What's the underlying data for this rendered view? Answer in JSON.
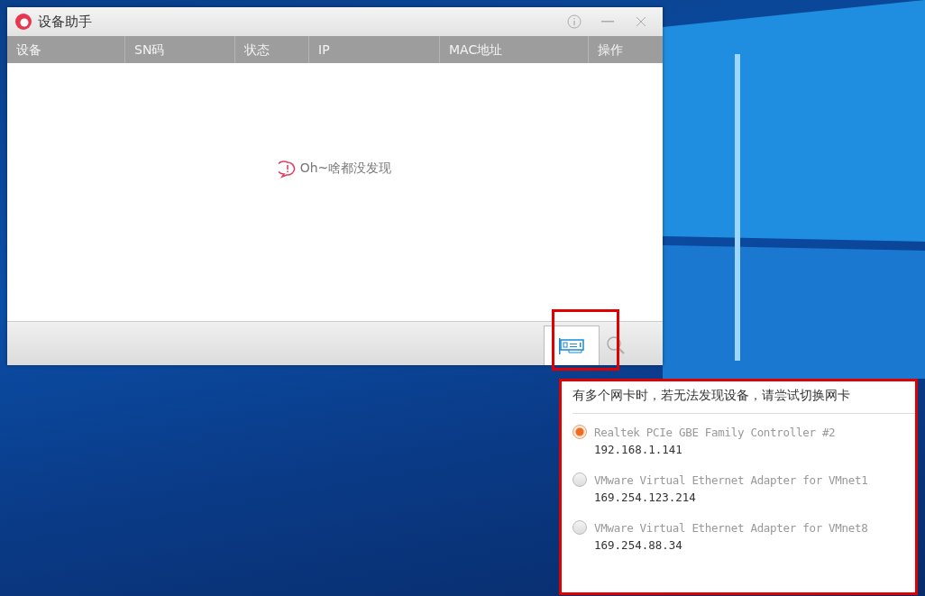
{
  "window": {
    "title": "设备助手"
  },
  "table": {
    "columns": [
      "设备",
      "SN码",
      "状态",
      "IP",
      "MAC地址",
      "操作"
    ],
    "empty_message": "Oh~啥都没发现"
  },
  "popup": {
    "hint": "有多个网卡时，若无法发现设备，请尝试切换网卡",
    "adapters": [
      {
        "name": "Realtek PCIe GBE Family Controller #2",
        "ip": "192.168.1.141",
        "selected": true
      },
      {
        "name": "VMware Virtual Ethernet Adapter for VMnet1",
        "ip": "169.254.123.214",
        "selected": false
      },
      {
        "name": "VMware Virtual Ethernet Adapter for VMnet8",
        "ip": "169.254.88.34",
        "selected": false
      }
    ]
  }
}
